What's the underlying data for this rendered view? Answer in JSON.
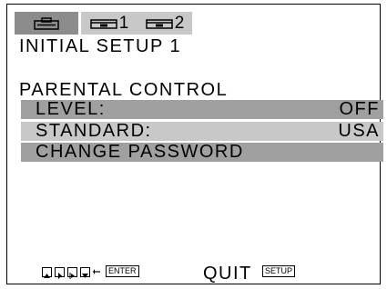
{
  "tabs": [
    {
      "icon": "disc-player-icon"
    },
    {
      "icon": "vcr-icon",
      "label": "1"
    },
    {
      "icon": "vcr-icon",
      "label": "2"
    }
  ],
  "title": "INITIAL SETUP 1",
  "section_title": "PARENTAL CONTROL",
  "rows": [
    {
      "label": "LEVEL:",
      "value": "OFF"
    },
    {
      "label": "STANDARD:",
      "value": "USA"
    },
    {
      "label": "CHANGE PASSWORD",
      "value": ""
    }
  ],
  "footer": {
    "nav_keys": [
      "up-arrow-key-icon",
      "right-arrow-key-icon",
      "play-key-icon",
      "down-arrow-key-icon"
    ],
    "enter_label": "ENTER",
    "quit_label": "QUIT",
    "setup_label": "SETUP"
  }
}
